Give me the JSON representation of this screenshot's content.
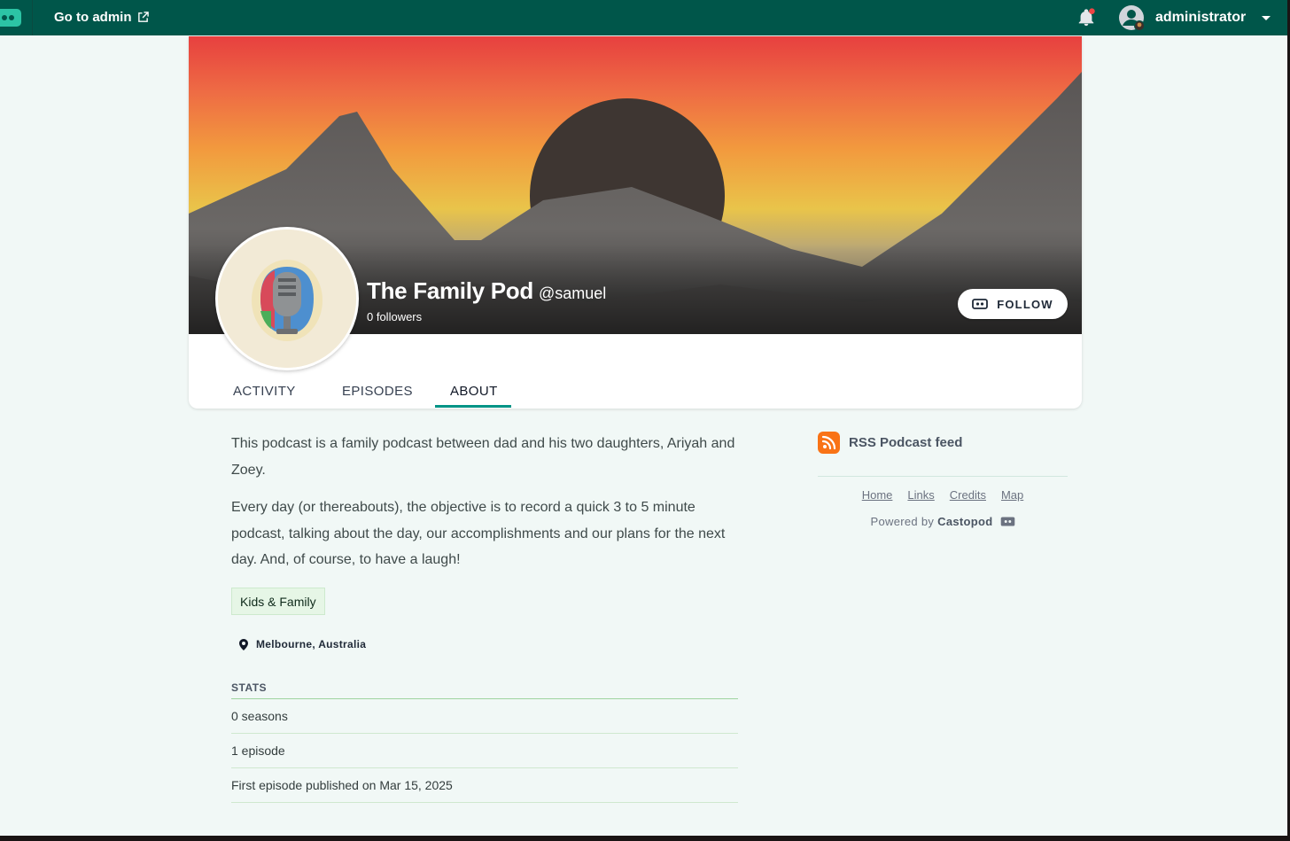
{
  "topbar": {
    "go_to_admin": "Go to admin",
    "username": "administrator",
    "bg_color": "#00564a",
    "notification_dot_color": "#ef4444"
  },
  "podcast": {
    "title": "The Family Pod",
    "handle": "@samuel",
    "followers": "0 followers",
    "follow_label": "FOLLOW"
  },
  "tabs": [
    {
      "label": "ACTIVITY"
    },
    {
      "label": "EPISODES"
    },
    {
      "label": "ABOUT",
      "active": true
    }
  ],
  "about": {
    "paragraph1": "This podcast is a family podcast between dad and his two daughters, Ariyah and Zoey.",
    "paragraph2": "Every day (or thereabouts), the objective is to record a quick 3 to 5 minute podcast, talking about the day, our accomplishments and our plans for the next day. And, of course, to have a laugh!",
    "category": "Kids & Family",
    "location": "Melbourne, Australia"
  },
  "stats": {
    "title": "STATS",
    "rows": [
      "0 seasons",
      "1 episode",
      "First episode published on Mar 15, 2025"
    ]
  },
  "sidebar": {
    "rss_label": "RSS Podcast feed",
    "links": [
      "Home",
      "Links",
      "Credits",
      "Map"
    ],
    "powered_prefix": "Powered by",
    "powered_brand": "Castopod"
  },
  "colors": {
    "accent": "#009486",
    "rss": "#f97316",
    "category_bg": "#e6f6e6"
  },
  "icons": [
    "logo-icon",
    "external-link-icon",
    "bell-icon",
    "user-avatar-icon",
    "chevron-down-icon",
    "castopod-icon",
    "map-pin-icon",
    "rss-icon"
  ]
}
